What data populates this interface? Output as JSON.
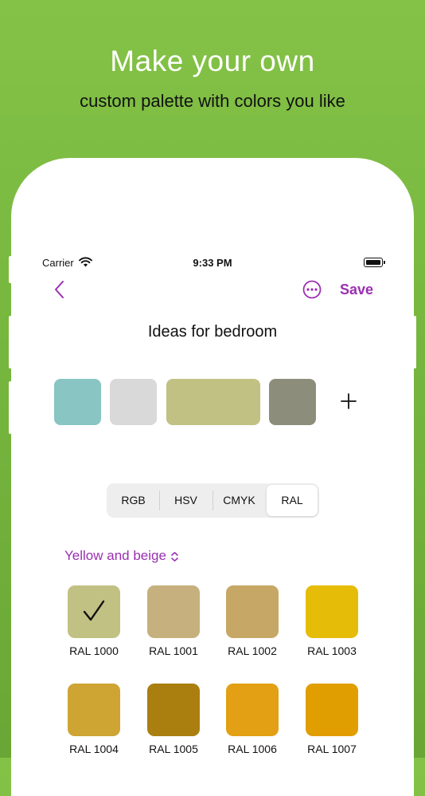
{
  "promo": {
    "headline": "Make your own",
    "subline": "custom palette with colors you like"
  },
  "status_bar": {
    "carrier": "Carrier",
    "time": "9:33 PM"
  },
  "nav": {
    "save_label": "Save"
  },
  "palette": {
    "title": "Ideas for bedroom",
    "swatches": [
      {
        "color": "#89c5c2"
      },
      {
        "color": "#d9d9d9"
      },
      {
        "color": "#c1c184"
      },
      {
        "color": "#8c8d7b"
      }
    ]
  },
  "color_modes": {
    "tabs": [
      "RGB",
      "HSV",
      "CMYK",
      "RAL"
    ],
    "selected": "RAL"
  },
  "ral_picker": {
    "category": "Yellow and beige",
    "colors": [
      {
        "label": "RAL 1000",
        "color": "#c2c184",
        "selected": true
      },
      {
        "label": "RAL 1001",
        "color": "#c6b07d",
        "selected": false
      },
      {
        "label": "RAL 1002",
        "color": "#c7a766",
        "selected": false
      },
      {
        "label": "RAL 1003",
        "color": "#e5bd08",
        "selected": false
      },
      {
        "label": "RAL 1004",
        "color": "#cea433",
        "selected": false
      },
      {
        "label": "RAL 1005",
        "color": "#aa7f10",
        "selected": false
      },
      {
        "label": "RAL 1006",
        "color": "#e3a014",
        "selected": false
      },
      {
        "label": "RAL 1007",
        "color": "#e09e00",
        "selected": false
      }
    ]
  },
  "accent_color": "#9a2fb0"
}
